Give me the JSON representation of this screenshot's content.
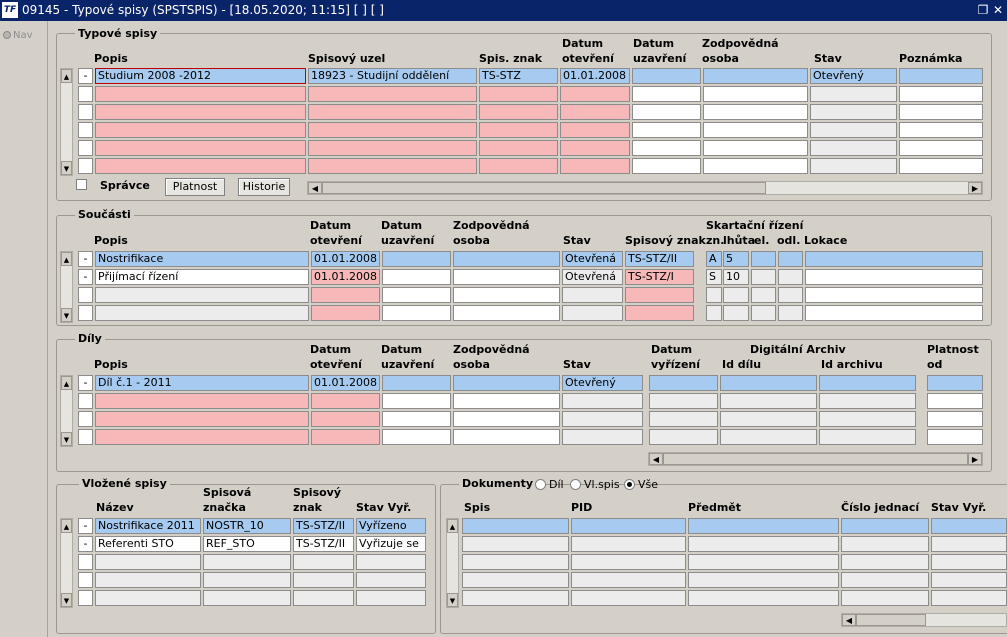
{
  "window": {
    "title": "09145 - Typové spisy (SPSTSPIS) - [18.05.2020; 11:15]  [ ]  [ ]",
    "logo": "TF"
  },
  "nav": {
    "label": "Nav"
  },
  "typove": {
    "legend": "Typové spisy",
    "headers": {
      "popis": "Popis",
      "uzel": "Spisový uzel",
      "znak": "Spis. znak",
      "otevreni": "Datum\notevření",
      "uzavreni": "Datum\nuzavření",
      "osoba": "Zodpovědná\nosoba",
      "stav": "Stav",
      "poznamka": "Poznámka"
    },
    "rows": [
      {
        "ind": "-",
        "popis": "Studium 2008 -2012",
        "uzel": "18923 - Studijní oddělení",
        "znak": "TS-STZ",
        "otevreni": "01.01.2008",
        "uzavreni": "",
        "osoba": "",
        "stav": "Otevřený",
        "poznamka": ""
      }
    ],
    "spravce": "Správce",
    "platnost": "Platnost",
    "historie": "Historie"
  },
  "soucasti": {
    "legend": "Součásti",
    "headers": {
      "popis": "Popis",
      "otevreni": "Datum\notevření",
      "uzavreni": "Datum\nuzavření",
      "osoba": "Zodpovědná\nosoba",
      "stav": "Stav",
      "znak": "Spisový znak",
      "skartacni": "Skartační řízení",
      "zn": "zn.",
      "lhuta": "lhůta",
      "el": "el.",
      "odl": "odl.",
      "lokace": "Lokace"
    },
    "rows": [
      {
        "ind": "-",
        "popis": "Nostrifikace",
        "otevreni": "01.01.2008",
        "stav": "Otevřená",
        "znak": "TS-STZ/II",
        "zn": "A",
        "lhuta": "5"
      },
      {
        "ind": "-",
        "popis": "Přijímací řízení",
        "otevreni": "01.01.2008",
        "stav": "Otevřená",
        "znak": "TS-STZ/I",
        "zn": "S",
        "lhuta": "10"
      }
    ]
  },
  "dily": {
    "legend": "Díly",
    "headers": {
      "popis": "Popis",
      "otevreni": "Datum\notevření",
      "uzavreni": "Datum\nuzavření",
      "osoba": "Zodpovědná\nosoba",
      "stav": "Stav",
      "vyrizeni": "Datum\nvyřízení",
      "archiv": "Digitální Archiv",
      "iddilu": "Id dílu",
      "idarchivu": "Id archivu",
      "platnost": "Platnost\nod"
    },
    "rows": [
      {
        "ind": "-",
        "popis": "Díl č.1 - 2011",
        "otevreni": "01.01.2008",
        "stav": "Otevřený"
      }
    ]
  },
  "vlozene": {
    "legend": "Vložené spisy",
    "headers": {
      "nazev": "Název",
      "znacka": "Spisová\nznačka",
      "znak": "Spisový\nznak",
      "stav": "Stav Vyř."
    },
    "rows": [
      {
        "ind": "-",
        "nazev": "Nostrifikace 2011",
        "znacka": "NOSTR_10",
        "znak": "TS-STZ/II",
        "stav": "Vyřízeno"
      },
      {
        "ind": "-",
        "nazev": "Referenti STO",
        "znacka": "REF_STO",
        "znak": "TS-STZ/II",
        "stav": "Vyřizuje se"
      }
    ]
  },
  "dokumenty": {
    "legend": "Dokumenty",
    "opt_dil": "Díl",
    "opt_vlspis": "Vl.spis",
    "opt_vse": "Vše",
    "selected": "Vše",
    "headers": {
      "spis": "Spis",
      "pid": "PID",
      "predmet": "Předmět",
      "cj": "Číslo jednací",
      "stav": "Stav Vyř."
    }
  }
}
